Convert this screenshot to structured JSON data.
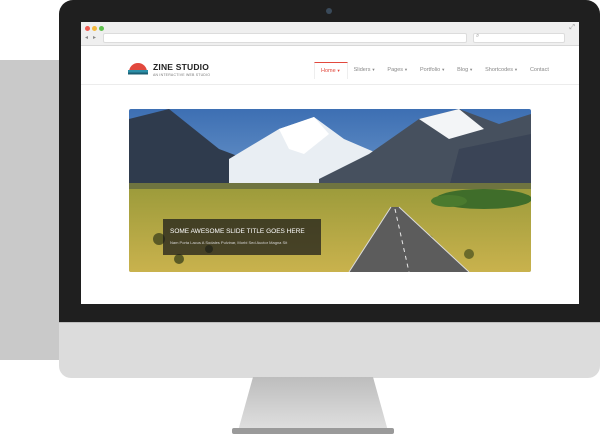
{
  "browser": {
    "address_value": "",
    "search_placeholder": ""
  },
  "site": {
    "brand": "ZINE STUDIO",
    "tagline": "AN INTERACTIVE WEB STUDIO"
  },
  "menu": [
    {
      "label": "Home",
      "dropdown": true,
      "active": true
    },
    {
      "label": "Sliders",
      "dropdown": true,
      "active": false
    },
    {
      "label": "Pages",
      "dropdown": true,
      "active": false
    },
    {
      "label": "Portfolio",
      "dropdown": true,
      "active": false
    },
    {
      "label": "Blog",
      "dropdown": true,
      "active": false
    },
    {
      "label": "Shortcodes",
      "dropdown": true,
      "active": false
    },
    {
      "label": "Contact",
      "dropdown": false,
      "active": false
    }
  ],
  "slide": {
    "title": "SOME AWESOME SLIDE TITLE GOES HERE",
    "subtitle": "Nam Porta Lacus A Sodales Pulvinar, Morbi Sed Auctor Magna Sit"
  },
  "colors": {
    "accent": "#e2483d",
    "bezel": "#1f1f1f",
    "chin": "#dcdcdc"
  },
  "icons": {
    "back": "chevron-left-icon",
    "forward": "chevron-right-icon",
    "search": "search-icon",
    "expand": "expand-icon"
  }
}
